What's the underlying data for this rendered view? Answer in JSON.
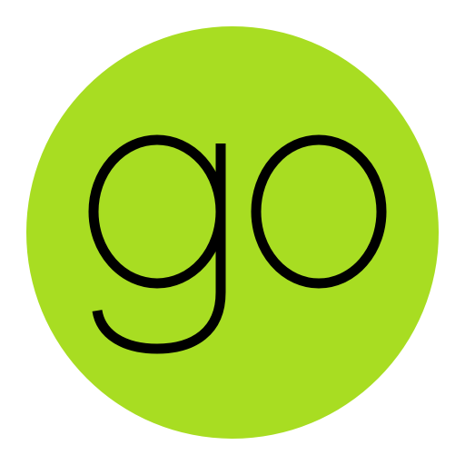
{
  "logo": {
    "word": "go",
    "circle_color": "#a8dd22",
    "stroke_color": "#000000",
    "background_color": "#ffffff"
  }
}
